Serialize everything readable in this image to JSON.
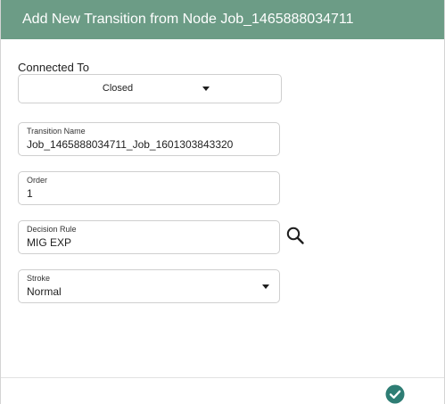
{
  "dialog": {
    "title": "Add New Transition from Node Job_1465888034711"
  },
  "connected_to": {
    "label": "Connected To",
    "value": "Closed"
  },
  "transition_name": {
    "label": "Transition Name",
    "value": "Job_1465888034711_Job_1601303843320"
  },
  "order": {
    "label": "Order",
    "value": "1"
  },
  "decision_rule": {
    "label": "Decision Rule",
    "value": "MIG EXP"
  },
  "stroke": {
    "label": "Stroke",
    "value": "Normal"
  },
  "icons": {
    "search": "search-icon",
    "confirm": "check-circle-icon",
    "dropdown": "caret-down-icon"
  },
  "colors": {
    "header_bg": "#6c9c86",
    "confirm": "#2e7d74"
  }
}
